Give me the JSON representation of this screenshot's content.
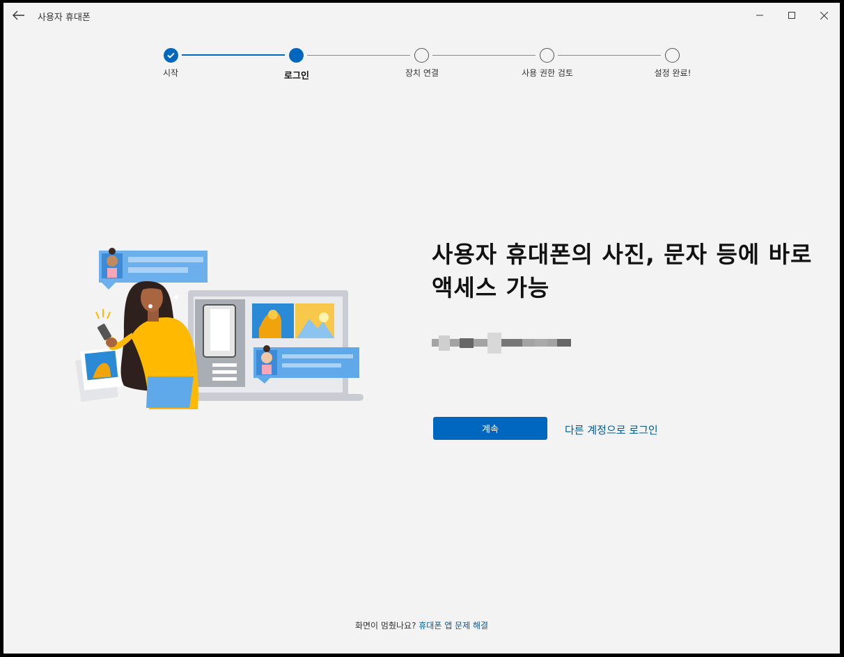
{
  "app": {
    "title": "사용자 휴대폰"
  },
  "steps": [
    {
      "label": "시작",
      "state": "done"
    },
    {
      "label": "로그인",
      "state": "current"
    },
    {
      "label": "장치 연결",
      "state": "todo"
    },
    {
      "label": "사용 권한 검토",
      "state": "todo"
    },
    {
      "label": "설정 완료!",
      "state": "todo"
    }
  ],
  "main": {
    "headline": "사용자 휴대폰의 사진, 문자 등에 바로 액세스 가능",
    "continue_label": "계속",
    "other_account_label": "다른 계정으로 로그인"
  },
  "footer": {
    "prompt": "화면이 멈췄나요?",
    "link": "휴대폰 앱 문제 해결"
  },
  "colors": {
    "accent": "#0067c0",
    "link": "#005a9e",
    "background": "#f3f3f3"
  },
  "icons": {
    "back": "arrow-left-icon",
    "minimize": "minimize-icon",
    "maximize": "maximize-icon",
    "close": "close-icon",
    "check": "check-icon"
  }
}
